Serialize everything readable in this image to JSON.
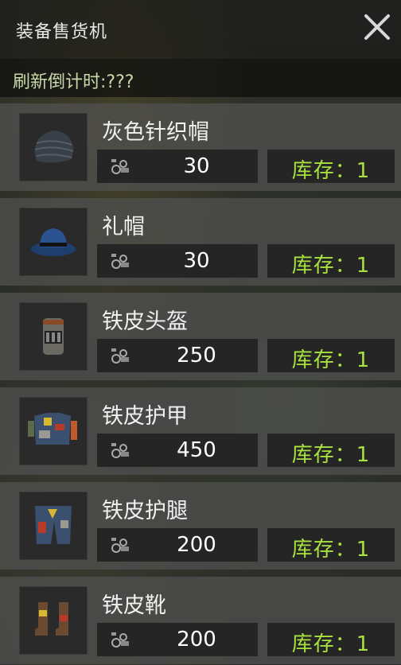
{
  "header": {
    "title": "装备售货机",
    "close_icon": "close-icon"
  },
  "timer": {
    "label": "刷新倒计时:???"
  },
  "colors": {
    "stock_text": "#a9e23f",
    "price_text": "#ffffff",
    "timer_text": "#c8d8a8"
  },
  "items": [
    {
      "name": "灰色针织帽",
      "icon": "knit-hat-icon",
      "currency_icon": "scrap-metal-icon",
      "price": "30",
      "stock": "库存：1"
    },
    {
      "name": "礼帽",
      "icon": "fedora-hat-icon",
      "currency_icon": "scrap-metal-icon",
      "price": "30",
      "stock": "库存：1"
    },
    {
      "name": "铁皮头盔",
      "icon": "metal-helmet-icon",
      "currency_icon": "scrap-metal-icon",
      "price": "250",
      "stock": "库存：1"
    },
    {
      "name": "铁皮护甲",
      "icon": "metal-armor-icon",
      "currency_icon": "scrap-metal-icon",
      "price": "450",
      "stock": "库存：1"
    },
    {
      "name": "铁皮护腿",
      "icon": "metal-leggings-icon",
      "currency_icon": "scrap-metal-icon",
      "price": "200",
      "stock": "库存：1"
    },
    {
      "name": "铁皮靴",
      "icon": "metal-boots-icon",
      "currency_icon": "scrap-metal-icon",
      "price": "200",
      "stock": "库存：1"
    }
  ]
}
